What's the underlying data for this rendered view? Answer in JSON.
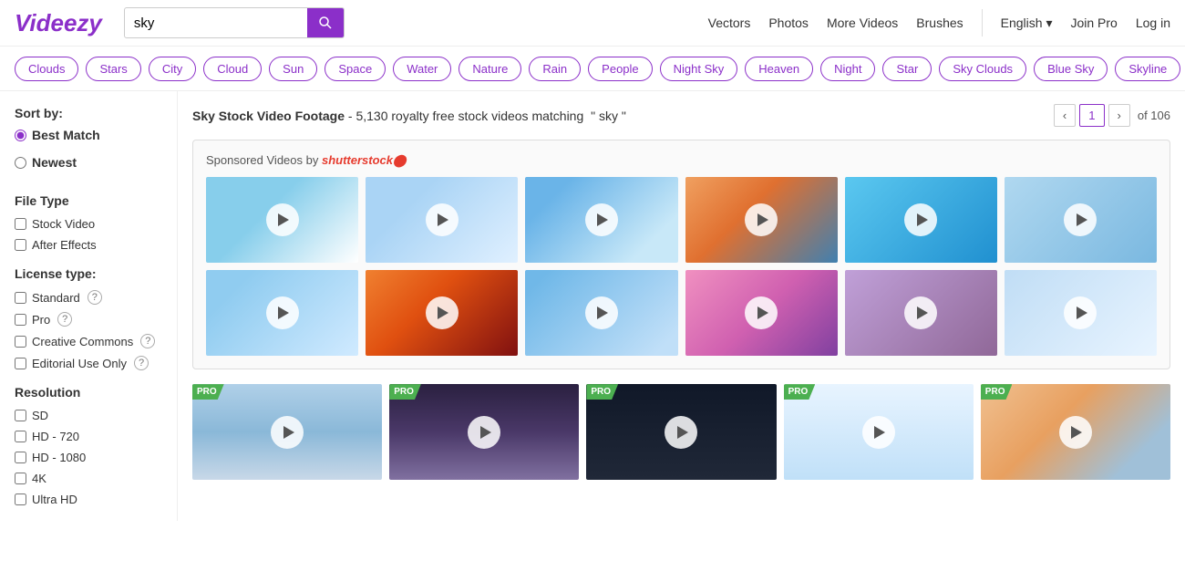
{
  "header": {
    "logo": "Videezy",
    "search_value": "sky",
    "nav": {
      "vectors": "Vectors",
      "photos": "Photos",
      "more_videos": "More Videos",
      "brushes": "Brushes",
      "language": "English",
      "join_pro": "Join Pro",
      "login": "Log in"
    }
  },
  "tags": [
    "Clouds",
    "Stars",
    "City",
    "Cloud",
    "Sun",
    "Space",
    "Water",
    "Nature",
    "Rain",
    "People",
    "Night Sky",
    "Heaven",
    "Night",
    "Star",
    "Sky Clouds",
    "Blue Sky",
    "Skyline"
  ],
  "sidebar": {
    "sort_label": "Sort by:",
    "sort_options": [
      "Best Match",
      "Newest"
    ],
    "file_type_label": "File Type",
    "file_types": [
      "Stock Video",
      "After Effects"
    ],
    "license_label": "License type:",
    "licenses": [
      {
        "label": "Standard",
        "help": true
      },
      {
        "label": "Pro",
        "help": true
      },
      {
        "label": "Creative Commons",
        "help": true
      },
      {
        "label": "Editorial Use Only",
        "help": true
      }
    ],
    "resolution_label": "Resolution",
    "resolutions": [
      "SD",
      "HD - 720",
      "HD - 1080",
      "4K",
      "Ultra HD"
    ]
  },
  "main": {
    "results_title": "Sky Stock Video Footage",
    "results_count": "- 5,130 royalty free stock videos matching",
    "search_term": "\" sky \"",
    "pagination": {
      "prev": "‹",
      "current": "1",
      "next": "›",
      "total": "of 106"
    },
    "sponsored_label": "Sponsored Videos by",
    "shutterstock": "shutterstock",
    "pro_badge": "PRO"
  }
}
